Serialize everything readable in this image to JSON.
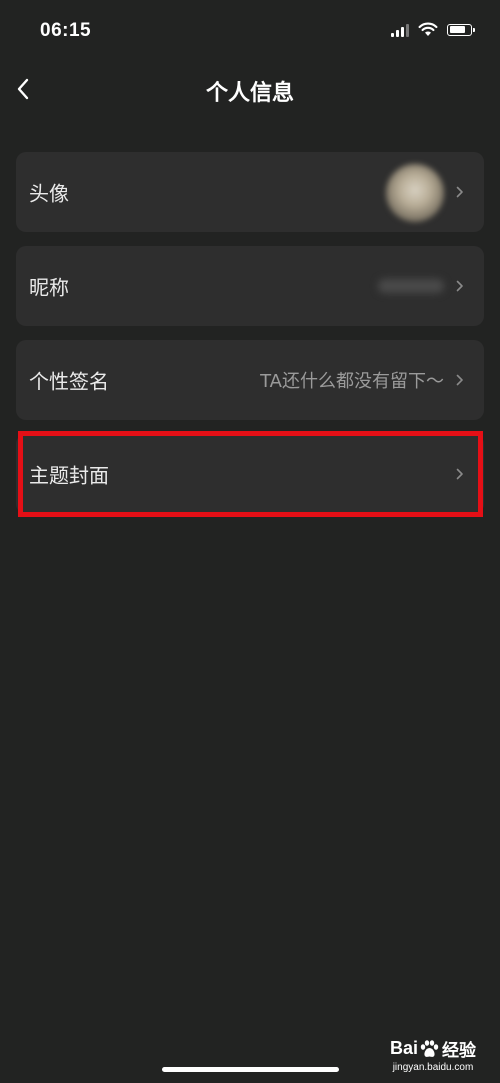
{
  "status_bar": {
    "time": "06:15"
  },
  "header": {
    "title": "个人信息",
    "back_icon": "chevron-left-icon"
  },
  "settings": {
    "items": [
      {
        "label": "头像",
        "type": "avatar"
      },
      {
        "label": "昵称",
        "type": "blurred-text"
      },
      {
        "label": "个性签名",
        "value": "TA还什么都没有留下～"
      },
      {
        "label": "主题封面"
      }
    ]
  },
  "annotation": {
    "highlight_color": "#e50f16",
    "highlighted_item": "主题封面"
  },
  "watermark": {
    "brand_part1": "Bai",
    "brand_part2": "经验",
    "url": "jingyan.baidu.com"
  },
  "colors": {
    "background": "#222322",
    "row_background": "#2e2e2e",
    "primary_text": "#eaeaea",
    "secondary_text": "#9a9a9a"
  }
}
